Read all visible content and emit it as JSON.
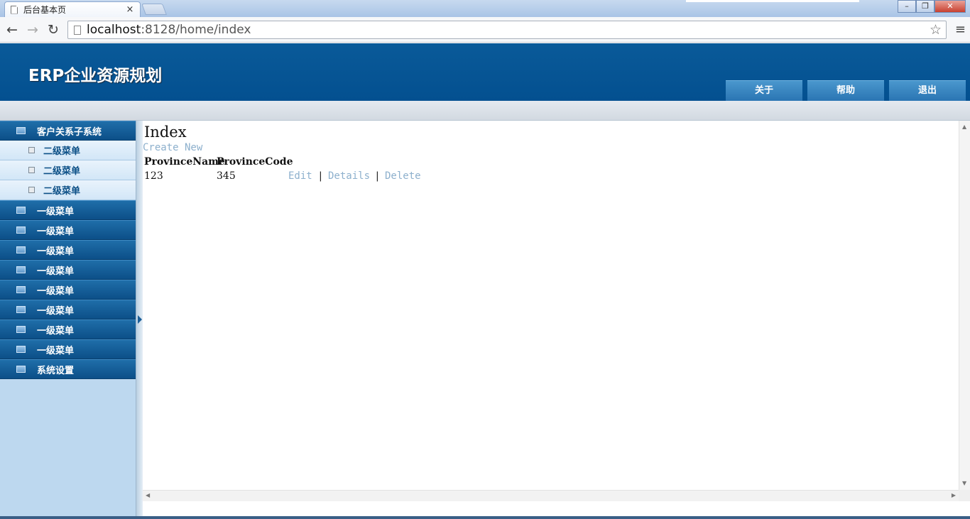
{
  "browser": {
    "tab_title": "后台基本页",
    "tab_close": "×",
    "url_host": "localhost",
    "url_path": ":8128/home/index",
    "back_glyph": "←",
    "forward_glyph": "→",
    "reload_glyph": "↻",
    "star_glyph": "☆",
    "menu_glyph": "≡",
    "win_minimize": "–",
    "win_restore": "❐",
    "win_close": "✕"
  },
  "header": {
    "title": "ERP企业资源规划",
    "buttons": [
      "关于",
      "帮助",
      "退出"
    ]
  },
  "sidebar": {
    "items": [
      {
        "label": "客户关系子系统",
        "level": 1
      },
      {
        "label": "二级菜单",
        "level": 2
      },
      {
        "label": "二级菜单",
        "level": 2
      },
      {
        "label": "二级菜单",
        "level": 2
      },
      {
        "label": "一级菜单",
        "level": 1
      },
      {
        "label": "一级菜单",
        "level": 1
      },
      {
        "label": "一级菜单",
        "level": 1
      },
      {
        "label": "一级菜单",
        "level": 1
      },
      {
        "label": "一级菜单",
        "level": 1
      },
      {
        "label": "一级菜单",
        "level": 1
      },
      {
        "label": "一级菜单",
        "level": 1
      },
      {
        "label": "一级菜单",
        "level": 1
      },
      {
        "label": "系统设置",
        "level": 1
      }
    ]
  },
  "content": {
    "heading": "Index",
    "create_link": "Create New",
    "columns": [
      "ProvinceName",
      "ProvinceCode"
    ],
    "rows": [
      {
        "name": "123",
        "code": "345"
      }
    ],
    "actions": [
      "Edit",
      "Details",
      "Delete"
    ],
    "separator": "|"
  },
  "scroll": {
    "up": "▲",
    "down": "▼",
    "left": "◀",
    "right": "▶"
  }
}
